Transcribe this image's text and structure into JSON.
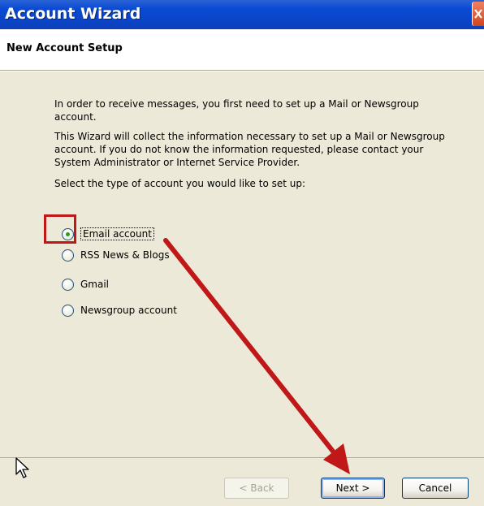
{
  "window": {
    "title": "Account Wizard",
    "close_icon": "close-icon"
  },
  "header": {
    "title": "New Account Setup"
  },
  "content": {
    "paragraph1": "In order to receive messages, you first need to set up a Mail or Newsgroup account.",
    "paragraph2": "This Wizard will collect the information necessary to set up a Mail or Newsgroup account. If you do not know the information requested, please contact your System Administrator or Internet Service Provider.",
    "paragraph3": "Select the type of account you would like to set up:",
    "options": [
      {
        "label": "Email account",
        "checked": true
      },
      {
        "label": "RSS News & Blogs",
        "checked": false
      },
      {
        "label": "Gmail",
        "checked": false
      },
      {
        "label": "Newsgroup account",
        "checked": false
      }
    ]
  },
  "buttons": {
    "back": "< Back",
    "next": "Next >",
    "cancel": "Cancel"
  },
  "annotations": {
    "highlight_color": "#c01818",
    "arrow_color": "#c01818"
  },
  "colors": {
    "titlebar": "#0a4ad3",
    "dialog_bg": "#ece9d8"
  }
}
